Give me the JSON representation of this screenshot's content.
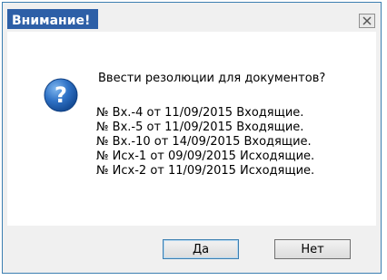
{
  "dialog": {
    "title": "Внимание!",
    "prompt": "Ввести резолюции для документов?",
    "documents": [
      "№ Вх.-4 от 11/09/2015 Входящие.",
      "№ Вх.-5 от 11/09/2015 Входящие.",
      "№ Вх.-10 от 14/09/2015 Входящие.",
      "№ Исх-1 от 09/09/2015 Исходящие.",
      "№ Исх-2 от 11/09/2015 Исходящие."
    ],
    "icon": "question-icon",
    "close_icon": "close-icon"
  },
  "buttons": {
    "yes_label": "Да",
    "no_label": "Нет"
  },
  "colors": {
    "title_accent": "#2d5fa7",
    "icon_blue": "#1e5fb4",
    "frame": "#f0f0f0"
  }
}
